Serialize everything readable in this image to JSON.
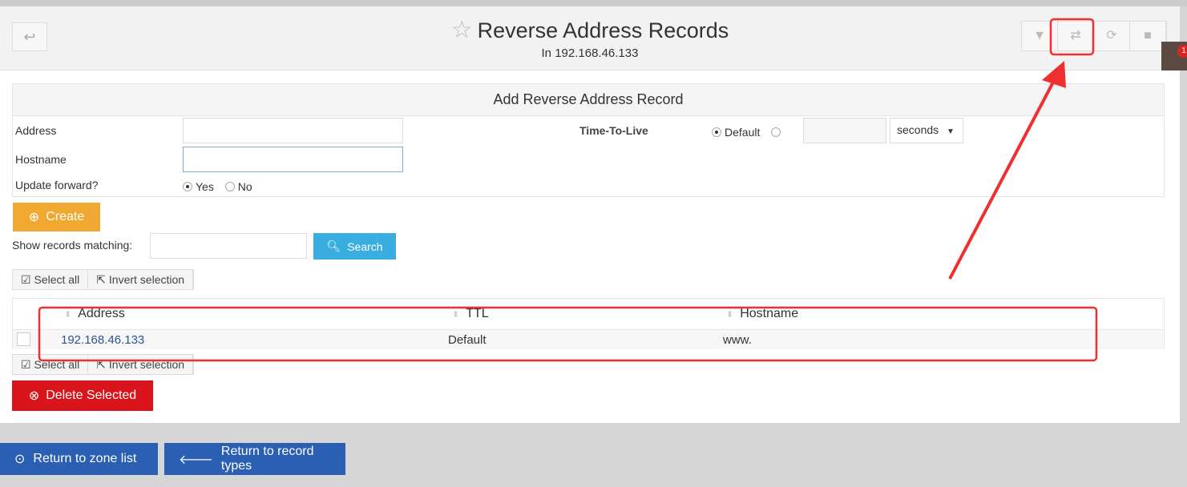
{
  "header": {
    "title": "Reverse Address Records",
    "subtitle": "In 192.168.46.133",
    "notification_count": "1"
  },
  "form": {
    "heading": "Add Reverse Address Record",
    "address_label": "Address",
    "address_value": "",
    "hostname_label": "Hostname",
    "hostname_value": "",
    "update_label": "Update forward?",
    "yes": "Yes",
    "no": "No",
    "ttl_label": "Time-To-Live",
    "ttl_default": "Default",
    "ttl_value": "",
    "ttl_unit": "seconds"
  },
  "create_label": "Create",
  "search": {
    "label": "Show records matching:",
    "value": "",
    "button": "Search"
  },
  "select_all": "Select all",
  "invert_selection": "Invert selection",
  "table": {
    "columns": [
      "Address",
      "TTL",
      "Hostname"
    ],
    "rows": [
      {
        "address": "192.168.46.133",
        "ttl": "Default",
        "hostname": "www."
      }
    ]
  },
  "delete_label": "Delete Selected",
  "footer": {
    "zone_list": "Return to zone list",
    "record_types": "Return to record types"
  },
  "colors": {
    "create": "#f0a830",
    "search": "#3aaee0",
    "delete": "#d9141a",
    "footer": "#2b5fb4",
    "annotation": "#f03030"
  }
}
